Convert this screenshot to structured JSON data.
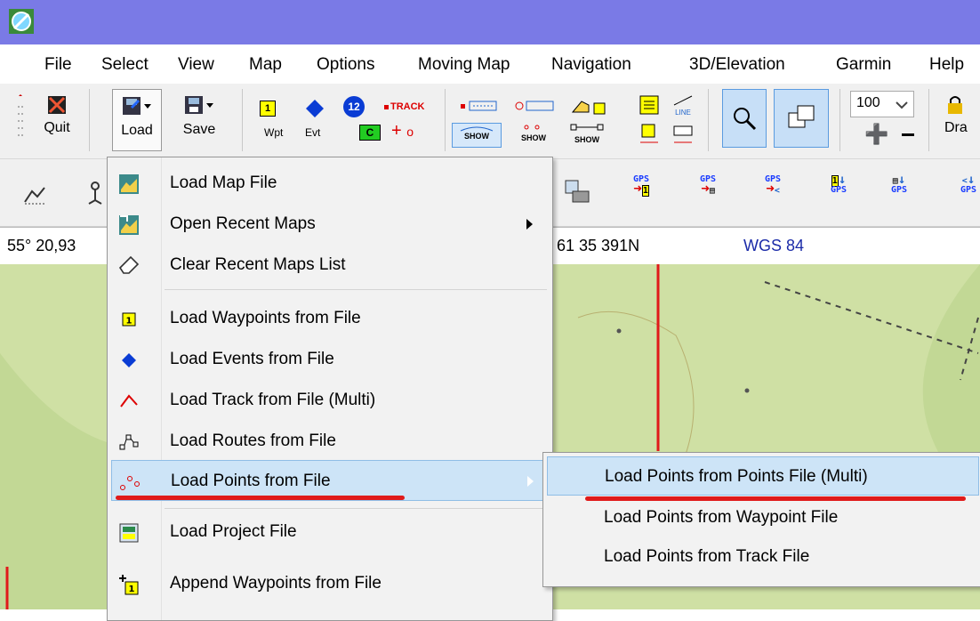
{
  "menubar": {
    "items": [
      "File",
      "Select",
      "View",
      "Map",
      "Options",
      "Moving Map",
      "Navigation",
      "3D/Elevation",
      "Garmin",
      "Help"
    ]
  },
  "toolbar": {
    "quit_label": "Quit",
    "load_label": "Load",
    "save_label": "Save",
    "wpt_label": "Wpt",
    "evt_label": "Evt",
    "track_label": "TRACK",
    "show_label": "SHOW",
    "line_label": "LINE",
    "zoom_value": "100",
    "draw_label": "Dra",
    "wpt_box": "1",
    "evt_box": "C",
    "evt_circle": "12"
  },
  "status": {
    "coord_left": "55° 20,93",
    "coord_mid": "61 35 391N",
    "datum": "WGS 84"
  },
  "dropdown": {
    "items": [
      {
        "label": "Load Map File",
        "icon": "map-file-icon"
      },
      {
        "label": "Open Recent Maps",
        "icon": "recent-maps-icon",
        "has_submenu": true
      },
      {
        "label": "Clear Recent Maps List",
        "icon": "eraser-icon"
      },
      {
        "label": "Load Waypoints from File",
        "icon": "waypoint-icon"
      },
      {
        "label": "Load Events from File",
        "icon": "event-diamond-icon"
      },
      {
        "label": "Load Track from File (Multi)",
        "icon": "track-icon"
      },
      {
        "label": "Load Routes from File",
        "icon": "route-icon"
      },
      {
        "label": "Load Points from File",
        "icon": "points-icon",
        "has_submenu": true,
        "highlighted": true
      },
      {
        "label": "Load Project File",
        "icon": "project-file-icon"
      },
      {
        "label": "Append Waypoints from File",
        "icon": "append-waypoints-icon"
      }
    ]
  },
  "submenu": {
    "items": [
      {
        "label": "Load Points from Points File (Multi)",
        "highlighted": true
      },
      {
        "label": "Load Points from Waypoint File"
      },
      {
        "label": "Load Points from Track File"
      }
    ]
  },
  "colors": {
    "title_bar": "#7a7ae6",
    "map_green": "#cfe0a4",
    "highlight": "#cde4f7",
    "annotation_red": "#e01a1a",
    "gps_blue": "#1a3cff"
  }
}
